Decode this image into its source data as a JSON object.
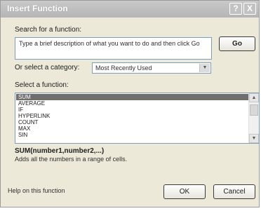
{
  "window": {
    "title": "Insert Function",
    "help_glyph": "?",
    "close_glyph": "X"
  },
  "search": {
    "label": "Search for a function:",
    "value": "Type a brief description of what you want to do and then click Go",
    "go_label": "Go"
  },
  "category": {
    "label": "Or select a category:",
    "selected": "Most Recently Used"
  },
  "functions": {
    "label": "Select a function:",
    "items": [
      {
        "label": "SUM",
        "selected": true
      },
      {
        "label": "AVERAGE",
        "selected": false
      },
      {
        "label": "IF",
        "selected": false
      },
      {
        "label": "HYPERLINK",
        "selected": false
      },
      {
        "label": "COUNT",
        "selected": false
      },
      {
        "label": "MAX",
        "selected": false
      },
      {
        "label": "SIN",
        "selected": false
      }
    ]
  },
  "details": {
    "signature": "SUM(number1,number2,...)",
    "description": "Adds all the numbers in a range of cells."
  },
  "footer": {
    "help_link": "Help on this function",
    "ok_label": "OK",
    "cancel_label": "Cancel"
  }
}
